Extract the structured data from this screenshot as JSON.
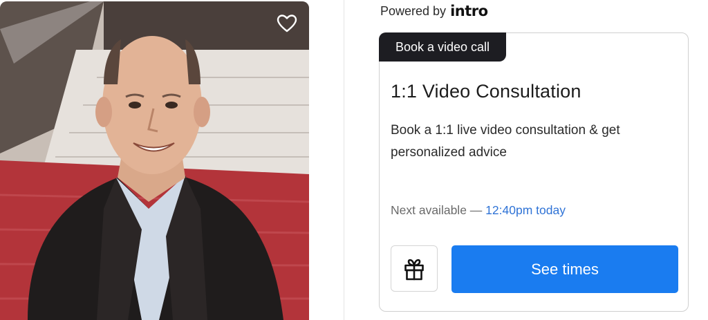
{
  "powered_by": {
    "label": "Powered by",
    "brand": "intro",
    "icon": "intro-logo"
  },
  "photo": {
    "icon": "heart-icon",
    "alt": "Portrait photo"
  },
  "card": {
    "tag": "Book a video call",
    "title": "1:1 Video Consultation",
    "description": "Book a 1:1 live video consultation & get personalized advice",
    "availability_label": "Next available —",
    "availability_time": "12:40pm today",
    "gift_icon": "gift-icon",
    "primary_button": "See times"
  },
  "colors": {
    "accent": "#1a7cf0",
    "tag_bg": "#1d1d22",
    "time_text": "#2f73d6"
  }
}
